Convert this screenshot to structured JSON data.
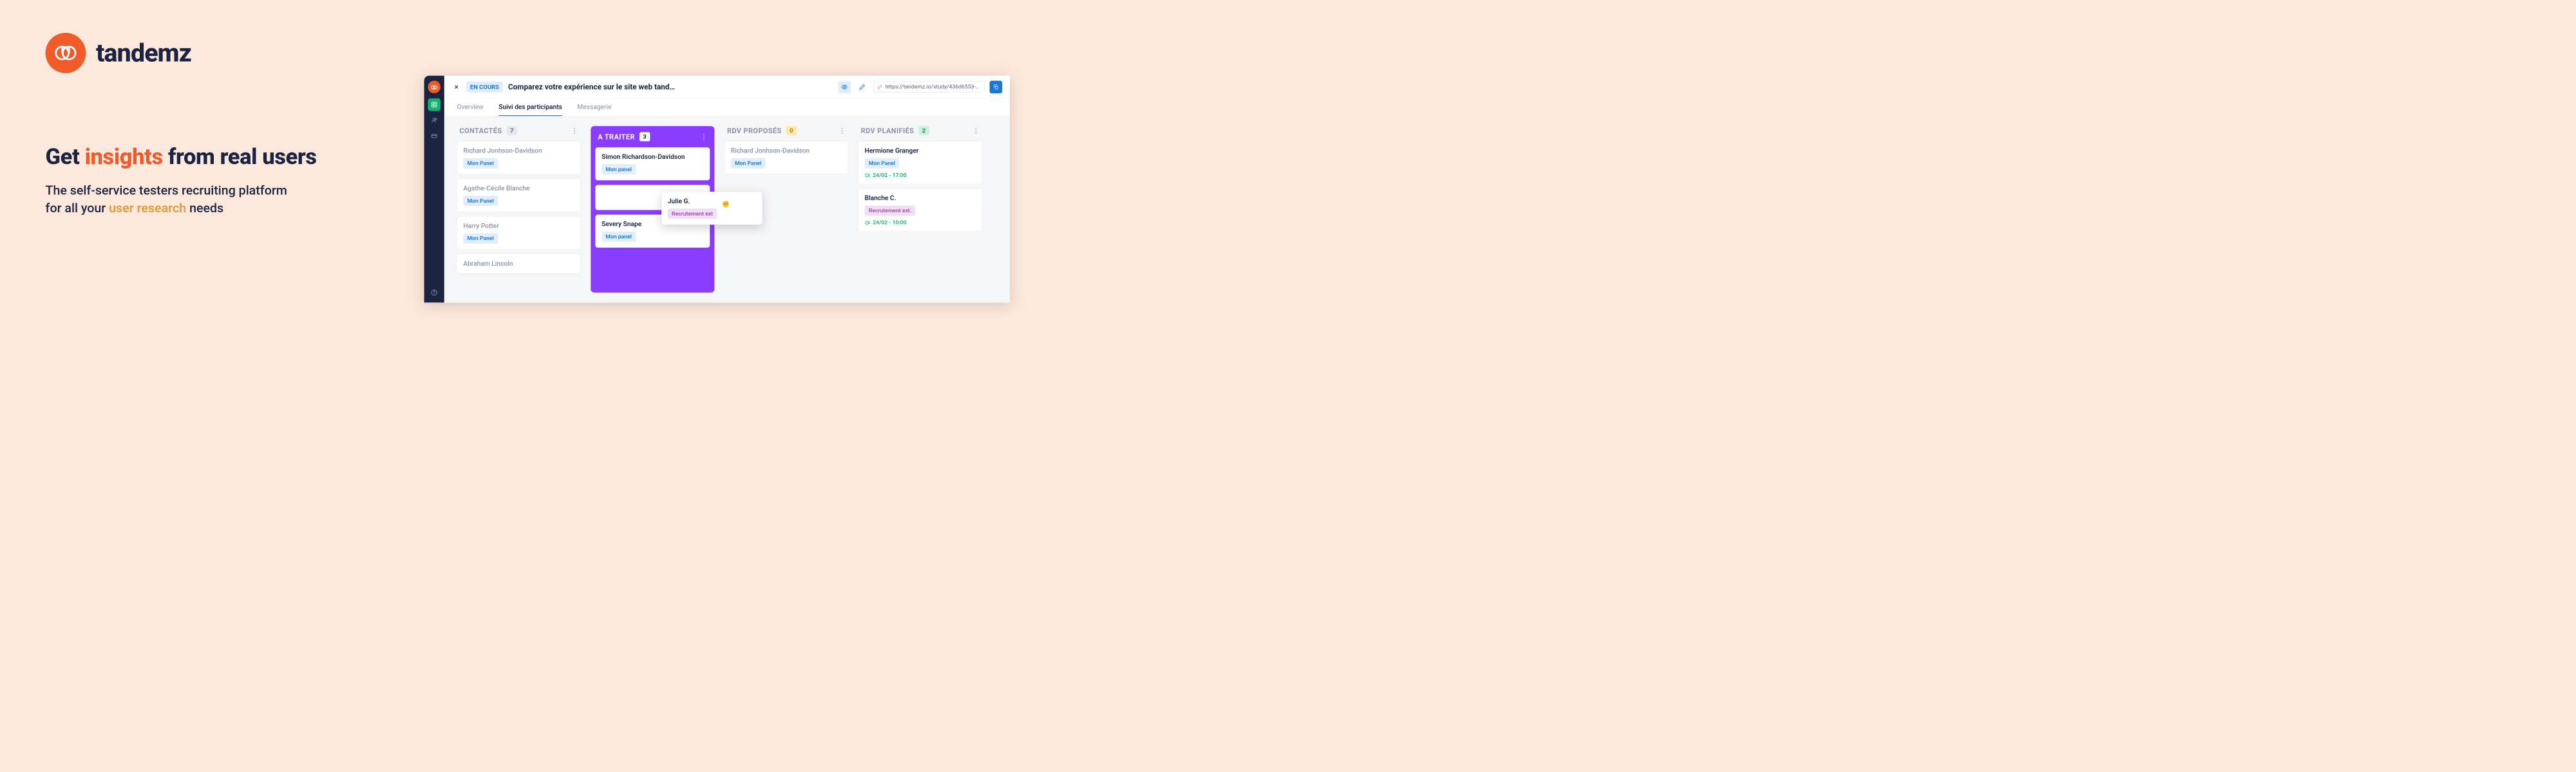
{
  "brand": {
    "name": "tandemz"
  },
  "marketing": {
    "headline_pre": "Get ",
    "headline_accent": "insights",
    "headline_post": " from real users",
    "sub_line1": "The self-service testers recruiting platform",
    "sub_line2_pre": "for all your ",
    "sub_line2_accent": "user research",
    "sub_line2_post": " needs"
  },
  "app": {
    "status": "EN COURS",
    "title": "Comparez votre expérience sur le site web tand…",
    "url": "https://tandemz.io/study/436d6553-21…"
  },
  "tabs": {
    "overview": "Overview",
    "participants": "Suivi des participants",
    "messaging": "Messagerie"
  },
  "columns": {
    "contacted": {
      "title": "CONTACTÉS",
      "count": "7"
    },
    "toprocess": {
      "title": "A TRAITER",
      "count": "3"
    },
    "proposed": {
      "title": "RDV PROPOSÉS",
      "count": "0"
    },
    "planned": {
      "title": "RDV PLANIFIÉS",
      "count": "2"
    }
  },
  "cards": {
    "c1_name": "Richard Jonhson-Davidson",
    "c1_tag": "Mon Panel",
    "c2_name": "Agathe-Cécile Blanche",
    "c2_tag": "Mon Panel",
    "c3_name": "Harry Potter",
    "c3_tag": "Mon Panel",
    "c4_name": "Abraham Lincoln",
    "t1_name": "Simon Richardson-Davidson",
    "t1_tag": "Mon panel",
    "t3_name": "Severy Snape",
    "t3_tag": "Mon panel",
    "p1_name": "Richard Jonhson-Davidson",
    "p1_tag": "Mon Panel",
    "pl1_name": "Hermione Granger",
    "pl1_tag": "Mon Panel",
    "pl1_date": "24/02 - 17:00",
    "pl2_name": "Blanche C.",
    "pl2_tag": "Recrutement ext.",
    "pl2_date": "24/02 - 10:00",
    "drag_name": "Julie G.",
    "drag_tag": "Recrutement ext"
  }
}
